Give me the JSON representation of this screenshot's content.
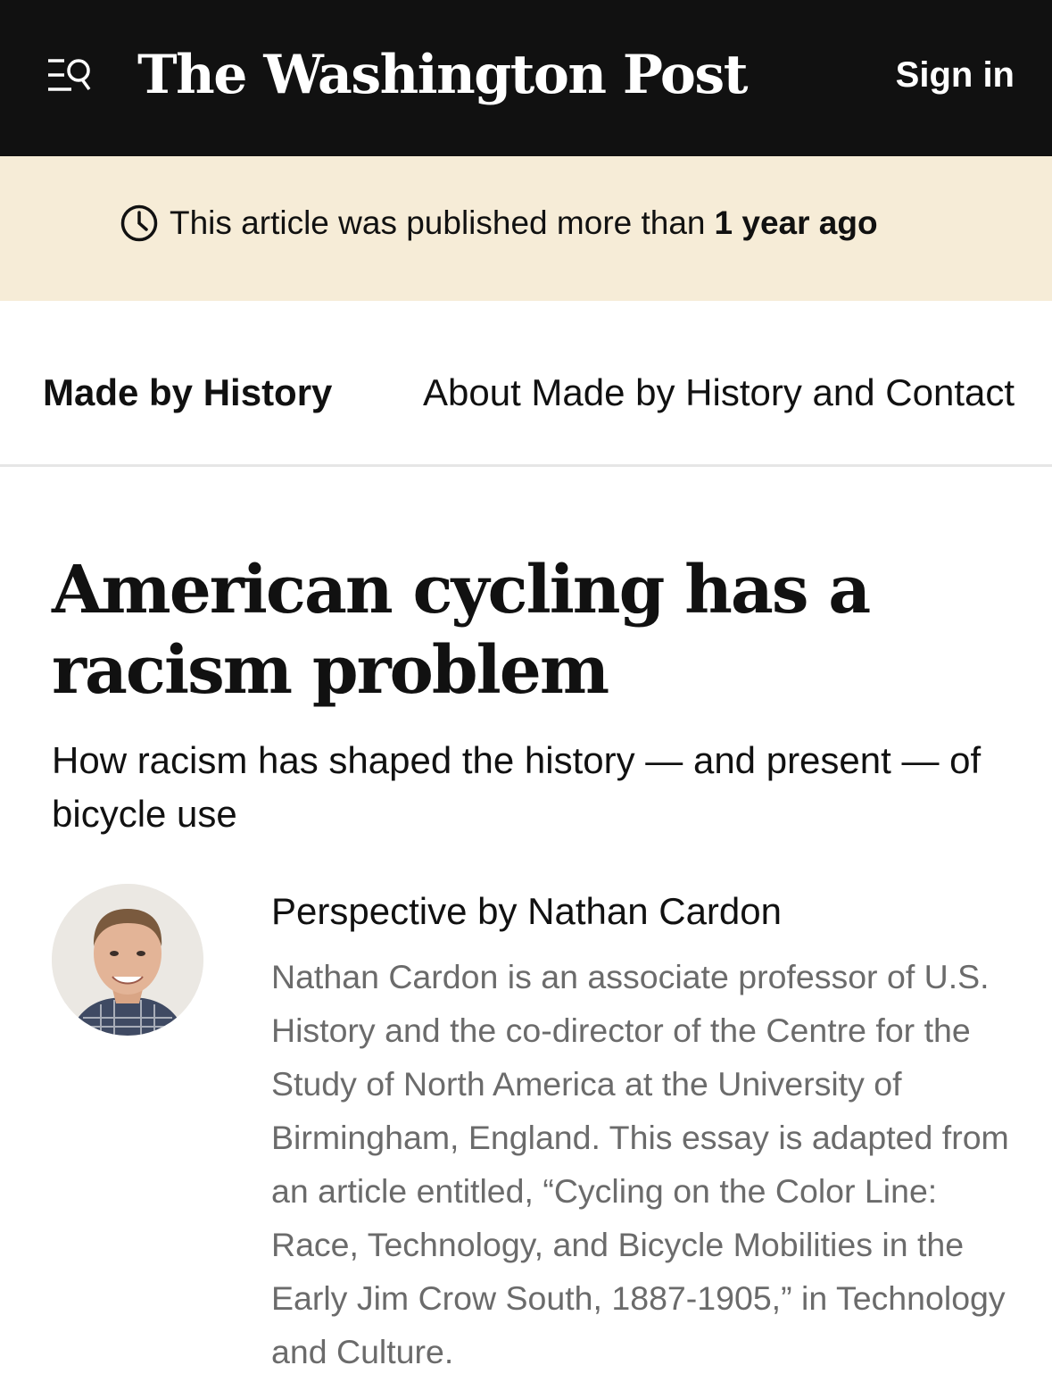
{
  "header": {
    "logo_text": "The Washington Post",
    "sign_in_label": "Sign in",
    "menu_icon": "menu-search-icon"
  },
  "notice": {
    "icon": "clock-icon",
    "text": "This article was published more than",
    "emphasis": "1 year ago"
  },
  "section_nav": {
    "section_title": "Made by History",
    "link_label": "About Made by History and Contact"
  },
  "article": {
    "headline": "American cycling has a racism problem",
    "subheadline": "How racism has shaped the history — and present — of bicycle use",
    "byline_prefix": "Perspective by",
    "author": "Nathan Cardon",
    "author_bio": "Nathan Cardon is an associate professor of U.S. History and the co-director of the Centre for the Study of North America at the University of Birmingham, England. This essay is adapted from an article entitled, “Cycling on the Color Line: Race, Technology, and Bicycle Mobilities in the Early Jim Crow South, 1887-1905,” in Technology and Culture."
  },
  "colors": {
    "header_bg": "#111111",
    "notice_bg": "#f6ecd7",
    "bio_text": "#6b6b6b"
  }
}
